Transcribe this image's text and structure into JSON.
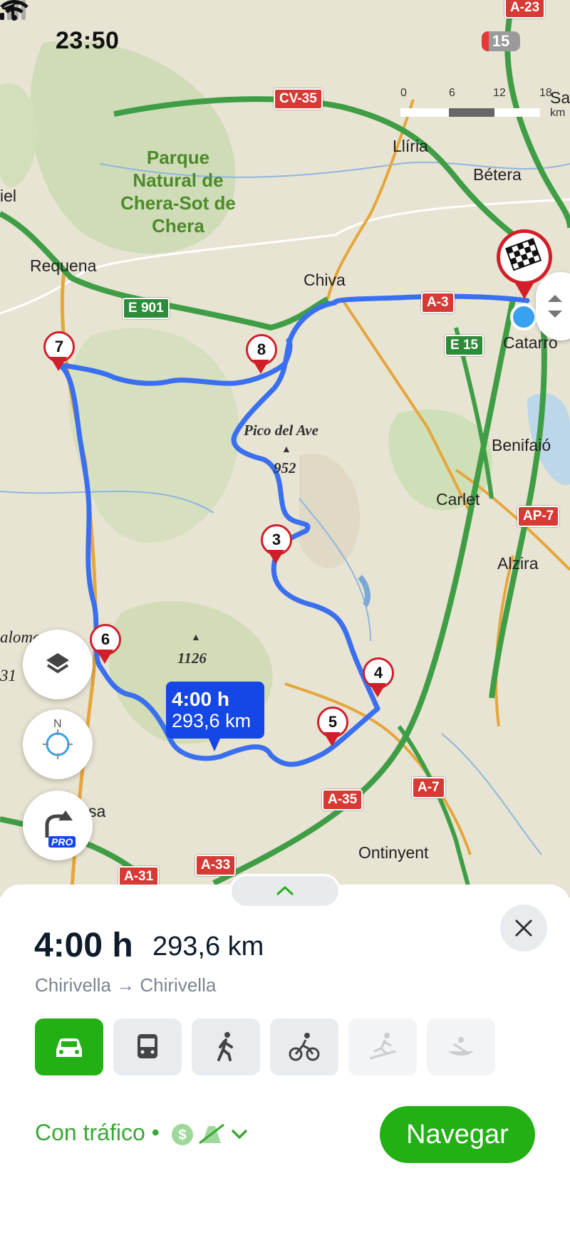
{
  "status_bar": {
    "time": "23:50",
    "battery": "15"
  },
  "scale": {
    "ticks": [
      "0",
      "6",
      "12",
      "18"
    ],
    "unit": "km"
  },
  "map": {
    "places": [
      "Llíria",
      "Bétera",
      "Requena",
      "Chiva",
      "Catarro",
      "Benifaió",
      "Carlet",
      "Alzira",
      "Ontinyent",
      "Sa",
      "iel",
      "alomer",
      "sa",
      "31"
    ],
    "park_label": [
      "Parque",
      "Natural de",
      "Chera-Sot de",
      "Chera"
    ],
    "peaks": [
      {
        "name": "Pico del Ave",
        "elevation": "952"
      },
      {
        "elevation": "1126"
      }
    ],
    "road_shields": [
      "A-23",
      "CV-35",
      "E 901",
      "A-3",
      "E 15",
      "AP-7",
      "A-7",
      "A-35",
      "A-33",
      "A-31"
    ],
    "waypoints": [
      "3",
      "4",
      "5",
      "6",
      "7",
      "8"
    ],
    "route_label": {
      "time": "4:00 h",
      "distance": "293,6 km"
    },
    "colors": {
      "route": "#3a6ff0",
      "waypoint": "#d11f2a",
      "motorway": "#3f9e45",
      "main_road": "#e6a63b"
    }
  },
  "controls": {
    "layers_icon": "layers-icon",
    "compass_label": "N",
    "pro_badge": "PRO"
  },
  "summary": {
    "time": "4:00 h",
    "distance": "293,6 km",
    "origin": "Chirivella",
    "arrow": "→",
    "destination": "Chirivella"
  },
  "transport_modes": [
    {
      "name": "car",
      "state": "active"
    },
    {
      "name": "bus",
      "state": "enabled"
    },
    {
      "name": "walk",
      "state": "enabled"
    },
    {
      "name": "bike",
      "state": "enabled"
    },
    {
      "name": "ski",
      "state": "disabled"
    },
    {
      "name": "boat",
      "state": "disabled"
    }
  ],
  "options": {
    "traffic_label": "Con tráfico",
    "separator": "•"
  },
  "navigate_label": "Navegar",
  "accent": "#22b014"
}
